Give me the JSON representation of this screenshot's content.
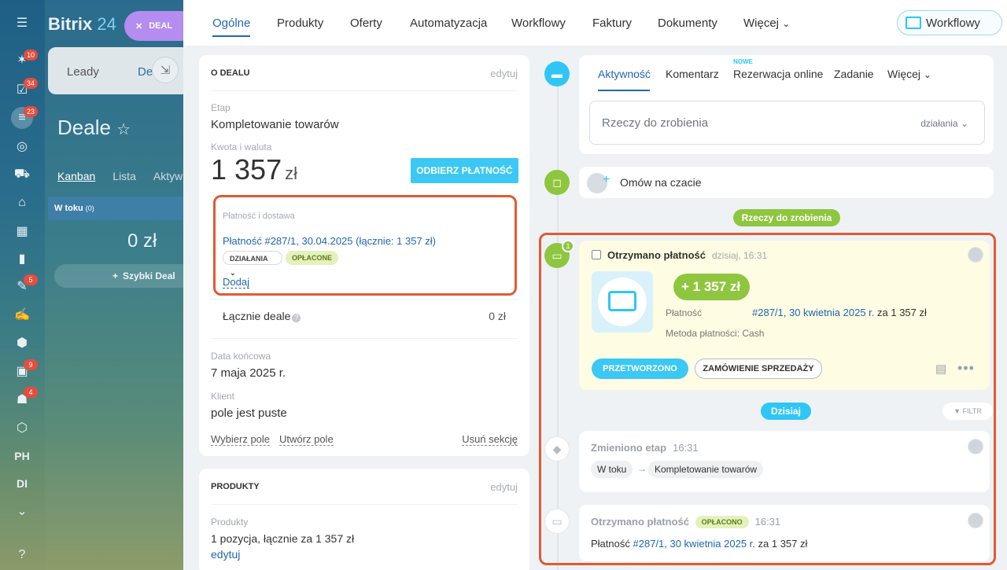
{
  "rail": {
    "badges": [
      "10",
      "34",
      "23",
      "5",
      "9",
      "4"
    ],
    "labels": [
      "PH",
      "DI"
    ]
  },
  "bg": {
    "logo_main": "Bitrix",
    "logo_num": "24",
    "deal_pill": "DEAL",
    "tab_leady": "Leady",
    "tab_deals": "De",
    "title": "Deale",
    "views": [
      "Kanban",
      "Lista",
      "Aktyw"
    ],
    "col_head": "W toku",
    "col_count": "(0)",
    "col_sum": "0 zł",
    "quick": "Szybki Deal"
  },
  "nav": {
    "tabs": [
      "Ogólne",
      "Produkty",
      "Oferty",
      "Automatyzacja",
      "Workflowy",
      "Faktury",
      "Dokumenty",
      "Więcej"
    ],
    "workflow_button": "Workflowy"
  },
  "deal": {
    "title": "O DEALU",
    "edit": "edytuj",
    "stage_label": "Etap",
    "stage": "Kompletowanie towarów",
    "amount_label": "Kwota i waluta",
    "amount": "1 357",
    "currency": "zł",
    "pay_button": "ODBIERZ PŁATNOŚĆ",
    "payment_label": "Płatność i dostawa",
    "payment_link": "Płatność #287/1, 30.04.2025 (łącznie: 1 357 zł)",
    "actions_chip": "DZIAŁANIA",
    "paid_chip": "OPŁACONE",
    "add": "Dodaj",
    "total_label": "Łącznie deale",
    "total_value": "0 zł",
    "end_label": "Data końcowa",
    "end_value": "7 maja 2025 r.",
    "client_label": "Klient",
    "client_value": "pole jest puste",
    "link_select": "Wybierz pole",
    "link_create": "Utwórz pole",
    "link_remove": "Usuń sekcję"
  },
  "products": {
    "title": "PRODUKTY",
    "edit": "edytuj",
    "label": "Produkty",
    "value": "1 pozycja, łącznie za 1 357 zł",
    "edit_link": "edytuj"
  },
  "editor": {
    "tabs": [
      "Aktywność",
      "Komentarz",
      "Rezerwacja online",
      "Zadanie",
      "Więcej"
    ],
    "new_badge": "NOWE",
    "placeholder": "Rzeczy do zrobienia",
    "actions": "działania"
  },
  "chat": {
    "text": "Omów na czacie"
  },
  "timeline": {
    "todo_pill": "Rzeczy do zrobienia",
    "today_pill": "Dzisiaj",
    "filter": "FILTR",
    "count_badge": "1"
  },
  "payment_item": {
    "title": "Otrzymano płatność",
    "time": "dzisiaj, 16:31",
    "amount": "+ 1 357 zł",
    "payment_label": "Płatność",
    "payment_link": "#287/1, 30 kwietnia 2025 r.",
    "payment_suffix": "za 1 357 zł",
    "method": "Metoda płatności: Cash",
    "btn_processed": "PRZETWORZONO",
    "btn_order": "ZAMÓWIENIE SPRZEDAŻY"
  },
  "history": [
    {
      "title": "Zmieniono etap",
      "time": "16:31",
      "from": "W toku",
      "to": "Kompletowanie towarów"
    },
    {
      "title": "Otrzymano płatność",
      "badge": "OPŁACONO",
      "time": "16:31",
      "prefix": "Płatność",
      "link": "#287/1, 30 kwietnia 2025 r.",
      "suffix": "za 1 357 zł"
    }
  ]
}
